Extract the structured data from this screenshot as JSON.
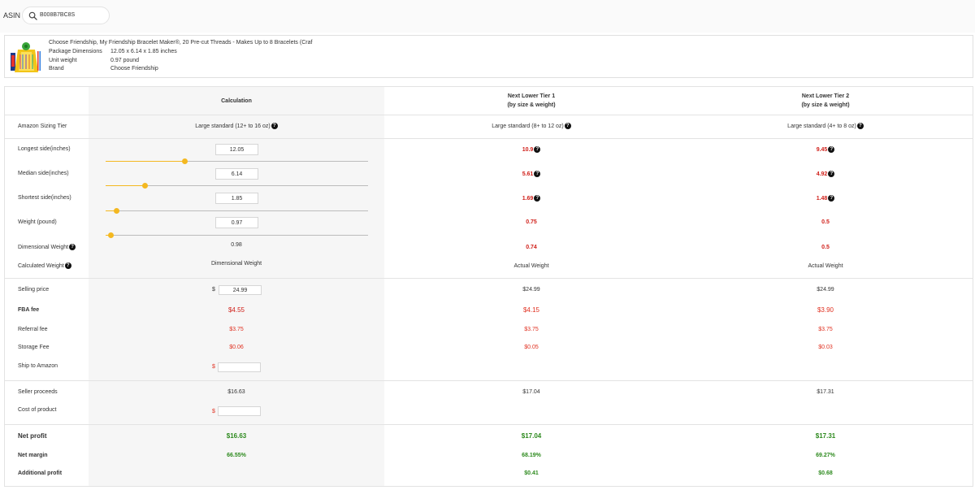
{
  "header": {
    "asin_label": "ASIN",
    "search_value": "B008B7BC8S",
    "search_icon": "search-icon"
  },
  "product": {
    "title": "Choose Friendship, My Friendship Bracelet Maker®, 20 Pre-cut Threads - Makes Up to 8 Bracelets (Craf",
    "rows": [
      {
        "key": "Package Dimensions",
        "value": "12.05 x 6.14 x 1.85 inches"
      },
      {
        "key": "Unit weight",
        "value": "0.97 pound"
      },
      {
        "key": "Brand",
        "value": "Choose Friendship"
      }
    ]
  },
  "table": {
    "headers": {
      "calc": "Calculation",
      "tier1_line1": "Next Lower Tier 1",
      "tier1_line2": "(by size & weight)",
      "tier2_line1": "Next Lower Tier 2",
      "tier2_line2": "(by size & weight)"
    },
    "labels": {
      "sizing_tier": "Amazon Sizing Tier",
      "longest": "Longest side(inches)",
      "median": "Median side(inches)",
      "shortest": "Shortest side(inches)",
      "weight": "Weight (pound)",
      "dim_weight": "Dimensional Weight",
      "calc_weight": "Calculated Weight",
      "selling_price": "Selling price",
      "fba_fee": "FBA fee",
      "referral_fee": "Referral fee",
      "storage_fee": "Storage Fee",
      "ship_to_amazon": "Ship to Amazon",
      "seller_proceeds": "Seller proceeds",
      "cost_of_product": "Cost of product",
      "net_profit": "Net profit",
      "net_margin": "Net margin",
      "additional_profit": "Additional profit"
    },
    "calc": {
      "sizing_tier": "Large standard (12+ to 16 oz)",
      "longest": "12.05",
      "median": "6.14",
      "shortest": "1.85",
      "weight": "0.97",
      "longest_slider": 0.3,
      "median_slider": 0.15,
      "shortest_slider": 0.04,
      "weight_slider": 0.02,
      "dim_weight": "0.98",
      "calc_weight": "Dimensional Weight",
      "currency": "$",
      "selling_price": "24.99",
      "fba_fee": "$4.55",
      "referral_fee": "$3.75",
      "storage_fee": "$0.06",
      "ship_to_amazon": "",
      "seller_proceeds": "$16.63",
      "cost_of_product": "",
      "net_profit": "$16.63",
      "net_margin": "66.55%"
    },
    "tier1": {
      "sizing_tier": "Large standard (8+ to 12 oz)",
      "longest": "10.9",
      "median": "5.61",
      "shortest": "1.69",
      "weight": "0.75",
      "dim_weight": "0.74",
      "calc_weight": "Actual Weight",
      "selling_price": "$24.99",
      "fba_fee": "$4.15",
      "referral_fee": "$3.75",
      "storage_fee": "$0.05",
      "seller_proceeds": "$17.04",
      "net_profit": "$17.04",
      "net_margin": "68.19%",
      "additional_profit": "$0.41"
    },
    "tier2": {
      "sizing_tier": "Large standard (4+ to 8 oz)",
      "longest": "9.45",
      "median": "4.92",
      "shortest": "1.48",
      "weight": "0.5",
      "dim_weight": "0.5",
      "calc_weight": "Actual Weight",
      "selling_price": "$24.99",
      "fba_fee": "$3.90",
      "referral_fee": "$3.75",
      "storage_fee": "$0.03",
      "seller_proceeds": "$17.31",
      "net_profit": "$17.31",
      "net_margin": "69.27%",
      "additional_profit": "$0.68"
    },
    "help_glyph": "?"
  },
  "colors": {
    "accent": "#f4b820",
    "fee_red": "#e03020",
    "profit_green": "#2d8a1e"
  }
}
